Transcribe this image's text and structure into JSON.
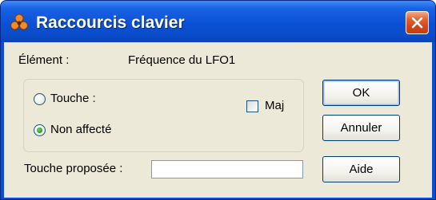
{
  "window": {
    "title": "Raccourcis clavier",
    "app_icon": "app-logo-icon",
    "close_icon": "close-icon"
  },
  "fields": {
    "element_label": "Élément :",
    "element_value": "Fréquence du LFO1"
  },
  "options": {
    "touche_label": "Touche :",
    "touche_checked": false,
    "maj_label": "Maj",
    "maj_checked": false,
    "non_affecte_label": "Non affecté",
    "non_affecte_checked": true
  },
  "proposed": {
    "label": "Touche proposée :",
    "value": ""
  },
  "buttons": {
    "ok": "OK",
    "cancel": "Annuler",
    "help": "Aide"
  },
  "colors": {
    "titlebar": "#0b51d6",
    "client_bg": "#ece9d8",
    "close_bg": "#d1451a",
    "radio_dot": "#2c9e28"
  }
}
